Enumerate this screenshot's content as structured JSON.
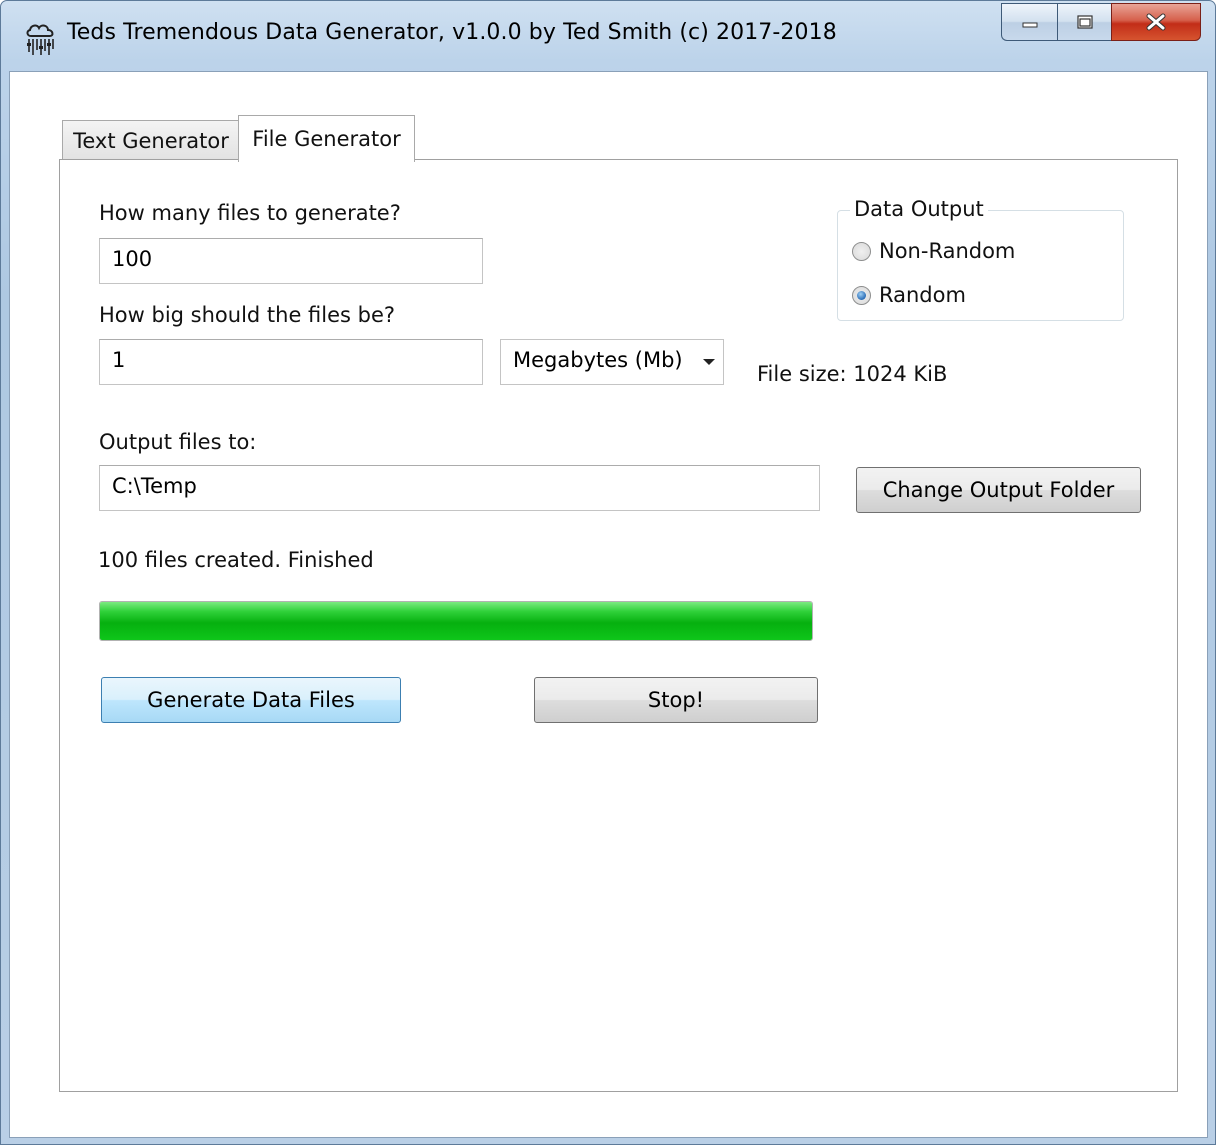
{
  "window": {
    "title": "Teds Tremendous Data Generator, v1.0.0 by Ted Smith (c) 2017-2018",
    "app_icon": "cloud-rain-icon",
    "controls": [
      "minimize-icon",
      "maximize-icon",
      "close-icon"
    ]
  },
  "tabs": [
    {
      "label": "Text Generator",
      "selected": false
    },
    {
      "label": "File Generator",
      "selected": true
    }
  ],
  "form": {
    "files_count_label": "How many files to generate?",
    "files_count_value": "100",
    "file_size_label": "How big should the files be?",
    "file_size_value": "1",
    "unit_selected": "Megabytes (Mb)",
    "file_size_info": "File size: 1024 KiB",
    "output_label": "Output files to:",
    "output_value": "C:\\Temp",
    "change_folder_button": "Change Output Folder",
    "status_text": "100 files created. Finished",
    "progress_percent": 100,
    "generate_button": "Generate Data Files",
    "stop_button": "Stop!"
  },
  "data_output": {
    "title": "Data Output",
    "options": [
      {
        "label": "Non-Random",
        "selected": false
      },
      {
        "label": "Random",
        "selected": true
      }
    ]
  },
  "colors": {
    "progress_green": "#06b00f",
    "primary_button": "#bee6fd",
    "close_red": "#c22d18"
  }
}
